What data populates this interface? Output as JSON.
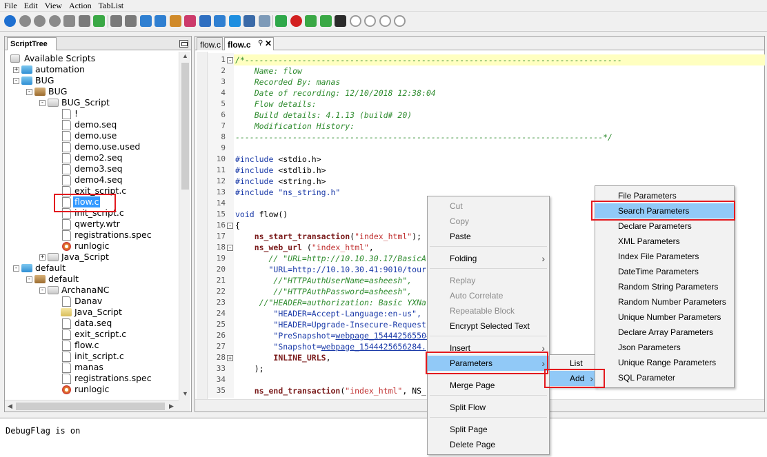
{
  "menubar": [
    "File",
    "Edit",
    "View",
    "Action",
    "TabList"
  ],
  "script_tree": {
    "tab_label": "ScriptTree",
    "items": [
      {
        "label": "Available Scripts",
        "depth": 0,
        "icon": "scripts-icon",
        "expander": ""
      },
      {
        "label": "automation",
        "depth": 1,
        "icon": "folder-blue",
        "expander": "+"
      },
      {
        "label": "BUG",
        "depth": 1,
        "icon": "folder-blue",
        "expander": "-"
      },
      {
        "label": "BUG",
        "depth": 2,
        "icon": "folder-brown",
        "expander": "-"
      },
      {
        "label": "BUG_Script",
        "depth": 3,
        "icon": "folder-grey",
        "expander": "-"
      },
      {
        "label": "!",
        "depth": 4,
        "icon": "file",
        "expander": ""
      },
      {
        "label": "demo.seq",
        "depth": 4,
        "icon": "file",
        "expander": ""
      },
      {
        "label": "demo.use",
        "depth": 4,
        "icon": "file",
        "expander": ""
      },
      {
        "label": "demo.use.used",
        "depth": 4,
        "icon": "file",
        "expander": ""
      },
      {
        "label": "demo2.seq",
        "depth": 4,
        "icon": "file",
        "expander": ""
      },
      {
        "label": "demo3.seq",
        "depth": 4,
        "icon": "file",
        "expander": ""
      },
      {
        "label": "demo4.seq",
        "depth": 4,
        "icon": "file",
        "expander": ""
      },
      {
        "label": "exit_script.c",
        "depth": 4,
        "icon": "file",
        "expander": ""
      },
      {
        "label": "flow.c",
        "depth": 4,
        "icon": "file",
        "expander": "",
        "selected": true
      },
      {
        "label": "init_script.c",
        "depth": 4,
        "icon": "file",
        "expander": ""
      },
      {
        "label": "qwerty.wtr",
        "depth": 4,
        "icon": "file",
        "expander": ""
      },
      {
        "label": "registrations.spec",
        "depth": 4,
        "icon": "file",
        "expander": ""
      },
      {
        "label": "runlogic",
        "depth": 4,
        "icon": "gear",
        "expander": ""
      },
      {
        "label": "Java_Script",
        "depth": 3,
        "icon": "folder-grey",
        "expander": "+"
      },
      {
        "label": "default",
        "depth": 1,
        "icon": "folder-blue",
        "expander": "-"
      },
      {
        "label": "default",
        "depth": 2,
        "icon": "folder-brown",
        "expander": "-"
      },
      {
        "label": "ArchanaNC",
        "depth": 3,
        "icon": "folder-grey",
        "expander": "-"
      },
      {
        "label": "Danav",
        "depth": 4,
        "icon": "file",
        "expander": ""
      },
      {
        "label": "Java_Script",
        "depth": 4,
        "icon": "folder-yellow",
        "expander": ""
      },
      {
        "label": "data.seq",
        "depth": 4,
        "icon": "file",
        "expander": ""
      },
      {
        "label": "exit_script.c",
        "depth": 4,
        "icon": "file",
        "expander": ""
      },
      {
        "label": "flow.c",
        "depth": 4,
        "icon": "file",
        "expander": ""
      },
      {
        "label": "init_script.c",
        "depth": 4,
        "icon": "file",
        "expander": ""
      },
      {
        "label": "manas",
        "depth": 4,
        "icon": "file",
        "expander": ""
      },
      {
        "label": "registrations.spec",
        "depth": 4,
        "icon": "file",
        "expander": ""
      },
      {
        "label": "runlogic",
        "depth": 4,
        "icon": "gear",
        "expander": ""
      }
    ]
  },
  "editor": {
    "tabs": [
      {
        "label": "flow.c",
        "active": false
      },
      {
        "label": "flow.c",
        "active": true
      }
    ],
    "lines": [
      {
        "n": "1",
        "fold": "-",
        "html": "<span class=\"cmt\">/*-------------------------------------------------------------------------------</span>"
      },
      {
        "n": "2",
        "fold": "",
        "html": "<span class=\"cmt\">    Name: flow</span>"
      },
      {
        "n": "3",
        "fold": "",
        "html": "<span class=\"cmt\">    Recorded By: manas</span>"
      },
      {
        "n": "4",
        "fold": "",
        "html": "<span class=\"cmt\">    Date of recording: 12/10/2018 12:38:04</span>"
      },
      {
        "n": "5",
        "fold": "",
        "html": "<span class=\"cmt\">    Flow details:</span>"
      },
      {
        "n": "6",
        "fold": "",
        "html": "<span class=\"cmt\">    Build details: 4.1.13 (build# 20)</span>"
      },
      {
        "n": "7",
        "fold": "",
        "html": "<span class=\"cmt\">    Modification History:</span>"
      },
      {
        "n": "8",
        "fold": "",
        "html": "<span class=\"cmt\">-----------------------------------------------------------------------------*/</span>"
      },
      {
        "n": "9",
        "fold": "",
        "html": ""
      },
      {
        "n": "10",
        "fold": "",
        "html": "<span class=\"kw\">#include</span> &lt;stdio.h&gt;"
      },
      {
        "n": "11",
        "fold": "",
        "html": "<span class=\"kw\">#include</span> &lt;stdlib.h&gt;"
      },
      {
        "n": "12",
        "fold": "",
        "html": "<span class=\"kw\">#include</span> &lt;string.h&gt;"
      },
      {
        "n": "13",
        "fold": "",
        "html": "<span class=\"kw\">#include</span> <span class=\"str\">\"ns_string.h\"</span>"
      },
      {
        "n": "14",
        "fold": "",
        "html": ""
      },
      {
        "n": "15",
        "fold": "",
        "html": "<span class=\"kw\">void</span> flow()"
      },
      {
        "n": "16",
        "fold": "-",
        "html": "{"
      },
      {
        "n": "17",
        "fold": "",
        "html": "    <span class=\"fn\">ns_start_transaction</span>(<span class=\"redstr\">\"index_html\"</span>);"
      },
      {
        "n": "18",
        "fold": "-",
        "html": "    <span class=\"fn\">ns_web_url</span> (<span class=\"redstr\">\"index_html\"</span>,"
      },
      {
        "n": "19",
        "fold": "",
        "html": "       <span class=\"cmt\">// \"URL=http://10.10.30.17/BasicA</span>"
      },
      {
        "n": "20",
        "fold": "",
        "html": "       <span class=\"str\">\"URL=http://10.10.30.41:9010/tour</span>"
      },
      {
        "n": "21",
        "fold": "",
        "html": "        <span class=\"cmt\">//\"HTTPAuthUserName=asheesh\",</span>"
      },
      {
        "n": "22",
        "fold": "",
        "html": "        <span class=\"cmt\">//\"HTTPAuthPassword=asheesh\",</span>"
      },
      {
        "n": "23",
        "fold": "",
        "html": "     <span class=\"cmt\">//\"HEADER=authorization: Basic YXNa</span>"
      },
      {
        "n": "24",
        "fold": "",
        "html": "        <span class=\"str\">\"HEADER=Accept-Language:en-us\",</span>"
      },
      {
        "n": "25",
        "fold": "",
        "html": "        <span class=\"str\">\"HEADER=Upgrade-Insecure-Request</span>"
      },
      {
        "n": "26",
        "fold": "",
        "html": "        <span class=\"str\">\"PreSnapshot=<span class=\"link\">webpage_154442565504</span></span>"
      },
      {
        "n": "27",
        "fold": "",
        "html": "        <span class=\"str\">\"Snapshot=<span class=\"link\">webpage_1544425656284.</span></span>"
      },
      {
        "n": "28",
        "fold": "+",
        "html": "        <span class=\"fn\">INLINE_URLS</span>,"
      },
      {
        "n": "33",
        "fold": "",
        "html": "    );"
      },
      {
        "n": "34",
        "fold": "",
        "html": ""
      },
      {
        "n": "35",
        "fold": "",
        "html": "    <span class=\"fn\">ns_end_transaction</span>(<span class=\"redstr\">\"index_html\"</span>, NS_"
      }
    ]
  },
  "debug": {
    "text": "DebugFlag is on"
  },
  "context_menu": {
    "items": [
      {
        "label": "Cut",
        "enabled": false,
        "submenu": false
      },
      {
        "label": "Copy",
        "enabled": false,
        "submenu": false
      },
      {
        "label": "Paste",
        "enabled": true,
        "submenu": false
      },
      {
        "label": "Folding",
        "enabled": true,
        "submenu": true
      },
      {
        "label": "Replay",
        "enabled": false,
        "submenu": false
      },
      {
        "label": "Auto Correlate",
        "enabled": false,
        "submenu": false
      },
      {
        "label": "Repeatable Block",
        "enabled": false,
        "submenu": false
      },
      {
        "label": "Encrypt Selected Text",
        "enabled": true,
        "submenu": false
      },
      {
        "label": "Insert",
        "enabled": true,
        "submenu": true
      },
      {
        "label": "Parameters",
        "enabled": true,
        "submenu": true,
        "selected": true
      },
      {
        "label": "Merge Page",
        "enabled": true,
        "submenu": false
      },
      {
        "label": "Split Flow",
        "enabled": true,
        "submenu": false
      },
      {
        "label": "Split Page",
        "enabled": true,
        "submenu": false
      },
      {
        "label": "Delete Page",
        "enabled": true,
        "submenu": false
      }
    ]
  },
  "parameters_submenu": {
    "items": [
      {
        "label": "List",
        "selected": false,
        "submenu": false
      },
      {
        "label": "Add",
        "selected": true,
        "submenu": true
      }
    ]
  },
  "add_submenu": {
    "items": [
      {
        "label": "File Parameters",
        "selected": false
      },
      {
        "label": "Search Parameters",
        "selected": true
      },
      {
        "label": "Declare Parameters",
        "selected": false
      },
      {
        "label": "XML Parameters",
        "selected": false
      },
      {
        "label": "Index File Parameters",
        "selected": false
      },
      {
        "label": "DateTime Parameters",
        "selected": false
      },
      {
        "label": "Random String Parameters",
        "selected": false
      },
      {
        "label": "Random Number Parameters",
        "selected": false
      },
      {
        "label": "Unique Number Parameters",
        "selected": false
      },
      {
        "label": "Declare Array Parameters",
        "selected": false
      },
      {
        "label": "Json Parameters",
        "selected": false
      },
      {
        "label": "Unique Range Parameters",
        "selected": false
      },
      {
        "label": "SQL Parameter",
        "selected": false
      }
    ]
  },
  "toolbar_icons": [
    "play-icon",
    "stop-icon",
    "cancel-icon",
    "pause-icon",
    "step-icon",
    "comment-icon",
    "add-page-icon",
    "save-icon",
    "copy-icon",
    "download-icon",
    "upload-icon",
    "settings-icon",
    "edit-icon",
    "search-icon",
    "gear-icon",
    "globe-icon",
    "tools-icon",
    "export-icon",
    "refresh-icon",
    "record-icon",
    "import-icon",
    "publish-icon",
    "disk-icon",
    "undo-icon",
    "back-icon",
    "forward-icon",
    "halt-icon"
  ],
  "colors": {
    "selection": "#91c9f7",
    "highlight_box": "#e3191e",
    "comment": "#2e8b2e",
    "keyword": "#1a3aa8",
    "function": "#7a1a1a"
  }
}
